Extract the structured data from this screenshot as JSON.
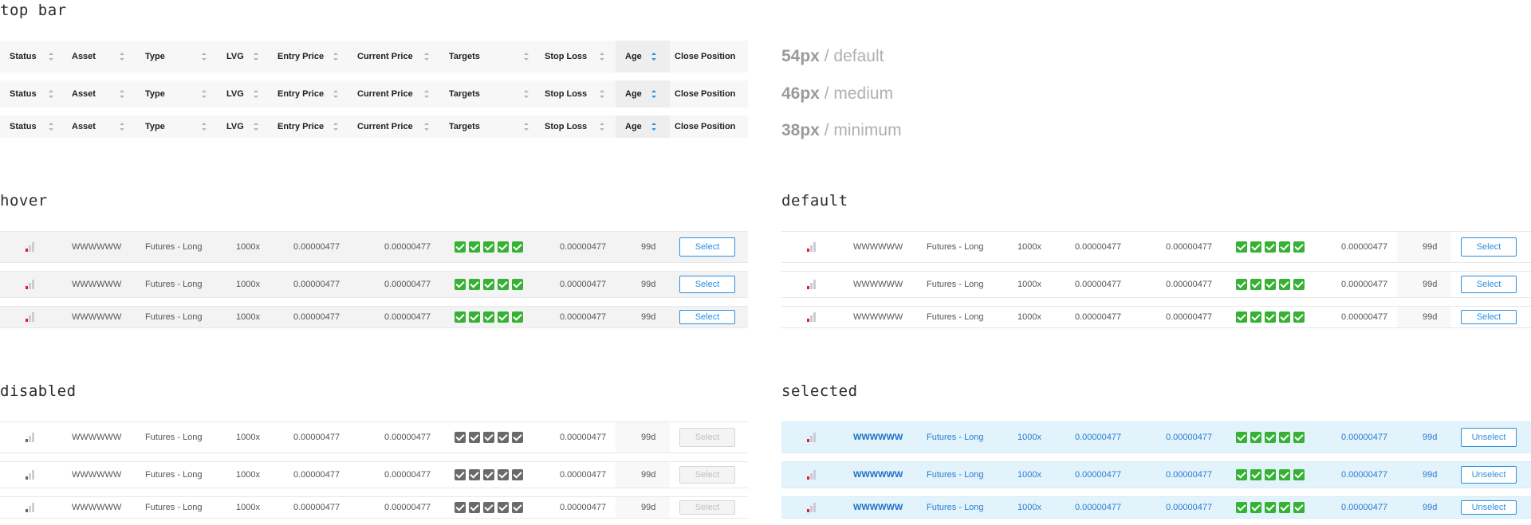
{
  "sections": {
    "top_bar": "top bar",
    "hover": "hover",
    "default": "default",
    "disabled": "disabled",
    "selected": "selected"
  },
  "columns": [
    "Status",
    "Asset",
    "Type",
    "LVG",
    "Entry Price",
    "Current Price",
    "Targets",
    "Stop Loss",
    "Age",
    "Close Position"
  ],
  "sizes": [
    {
      "value": "54px",
      "name": "/ default"
    },
    {
      "value": "46px",
      "name": "/ medium"
    },
    {
      "value": "38px",
      "name": "/ minimum"
    }
  ],
  "row": {
    "asset": "WWWWWW",
    "type": "Futures - Long",
    "lvg": "1000x",
    "entry_price": "0.00000477",
    "current_price": "0.00000477",
    "targets_count": 5,
    "stop_loss": "0.00000477",
    "age": "99d"
  },
  "buttons": {
    "select": "Select",
    "unselect": "Unselect"
  },
  "colors": {
    "accent": "#2a8fe0",
    "check_green": "#35b133",
    "signal_red": "#e21b2a",
    "selected_bg": "#e2f3fb"
  }
}
